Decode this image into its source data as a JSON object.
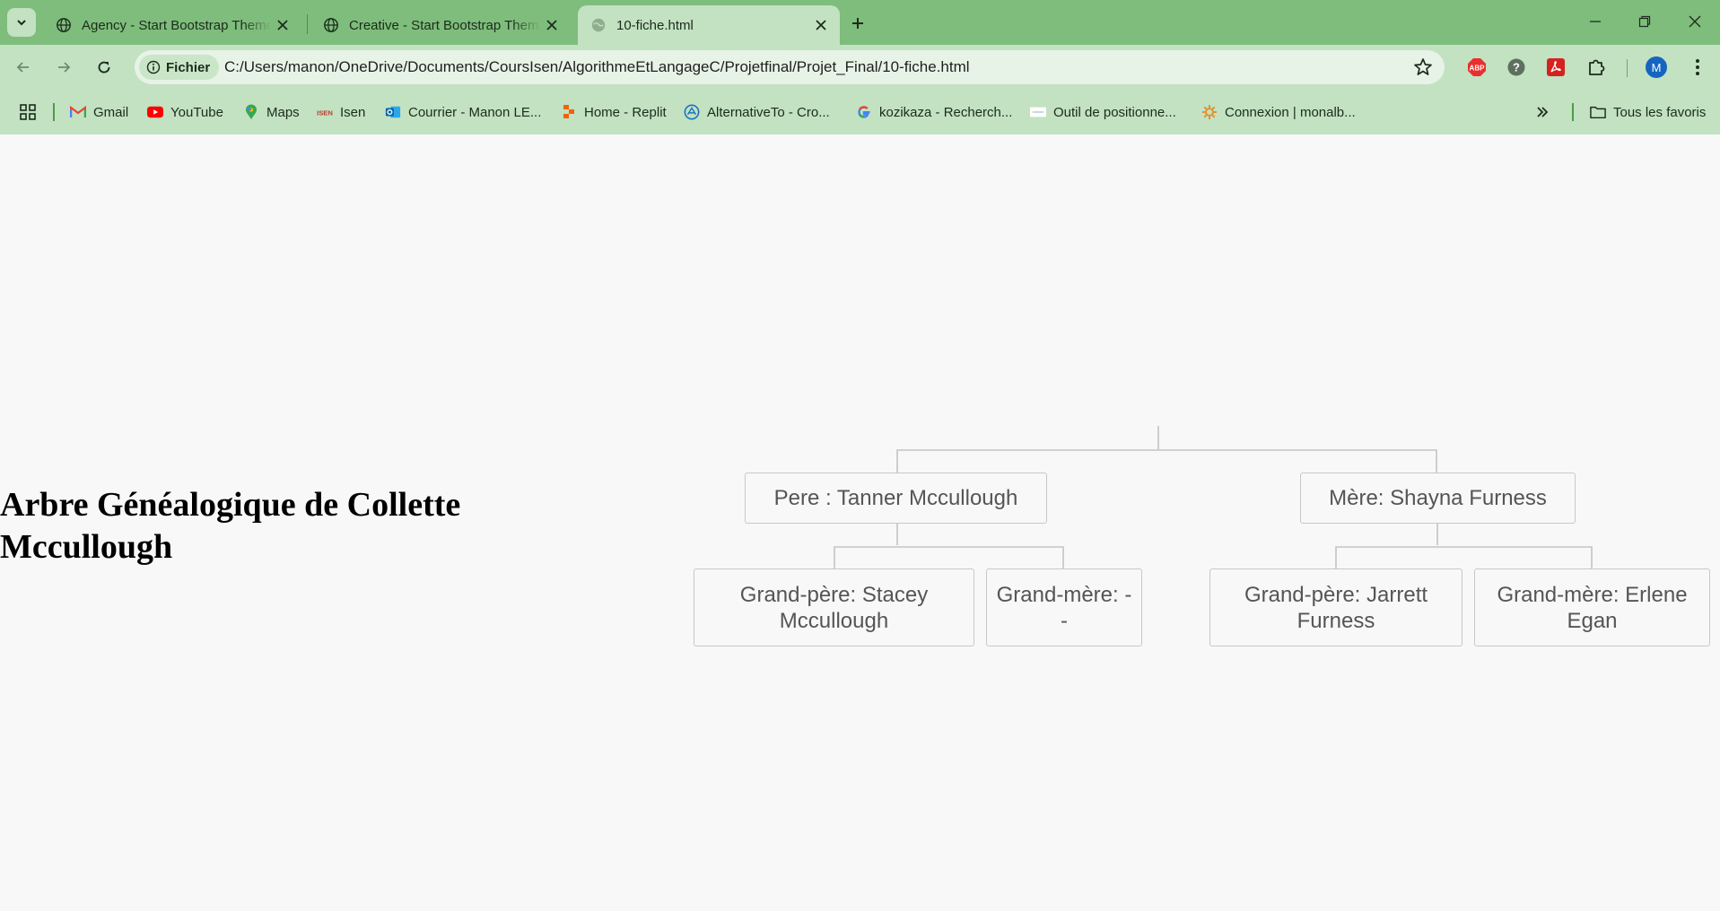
{
  "browser": {
    "tabs": [
      {
        "title": "Agency - Start Bootstrap Theme",
        "icon": "globe-icon",
        "active": false
      },
      {
        "title": "Creative - Start Bootstrap Theme",
        "icon": "globe-icon",
        "active": false
      },
      {
        "title": "10-fiche.html",
        "icon": "globe-icon",
        "active": true
      }
    ],
    "address": {
      "chip_label": "Fichier",
      "url": "C:/Users/manon/OneDrive/Documents/CoursIsen/AlgorithmeEtLangageC/Projetfinal/Projet_Final/10-fiche.html"
    },
    "profile_initial": "M",
    "extensions": [
      "abp-icon",
      "help-icon",
      "pdf-icon",
      "extensions-puzzle-icon"
    ],
    "bookmarks": [
      {
        "label": "Gmail",
        "icon": "gmail-icon"
      },
      {
        "label": "YouTube",
        "icon": "youtube-icon"
      },
      {
        "label": "Maps",
        "icon": "maps-pin-icon"
      },
      {
        "label": "Isen",
        "icon": "isen-icon"
      },
      {
        "label": "Courrier - Manon LE...",
        "icon": "outlook-icon"
      },
      {
        "label": "Home - Replit",
        "icon": "replit-icon"
      },
      {
        "label": "AlternativeTo - Cro...",
        "icon": "alternativeto-icon"
      },
      {
        "label": "kozikaza - Recherch...",
        "icon": "google-icon"
      },
      {
        "label": "Outil de positionne...",
        "icon": "site-icon"
      },
      {
        "label": "Connexion | monalb...",
        "icon": "gear-sun-icon"
      }
    ],
    "all_bookmarks_label": "Tous les favoris"
  },
  "page": {
    "title": "Arbre Généalogique de Collette Mccullough",
    "tree": {
      "father": "Pere : Tanner Mccullough",
      "mother": "Mère: Shayna Furness",
      "paternal_grandfather": "Grand-père: Stacey Mccullough",
      "paternal_grandmother": "Grand-mère: - -",
      "maternal_grandfather": "Grand-père: Jarrett Furness",
      "maternal_grandmother": "Grand-mère: Erlene Egan"
    }
  }
}
